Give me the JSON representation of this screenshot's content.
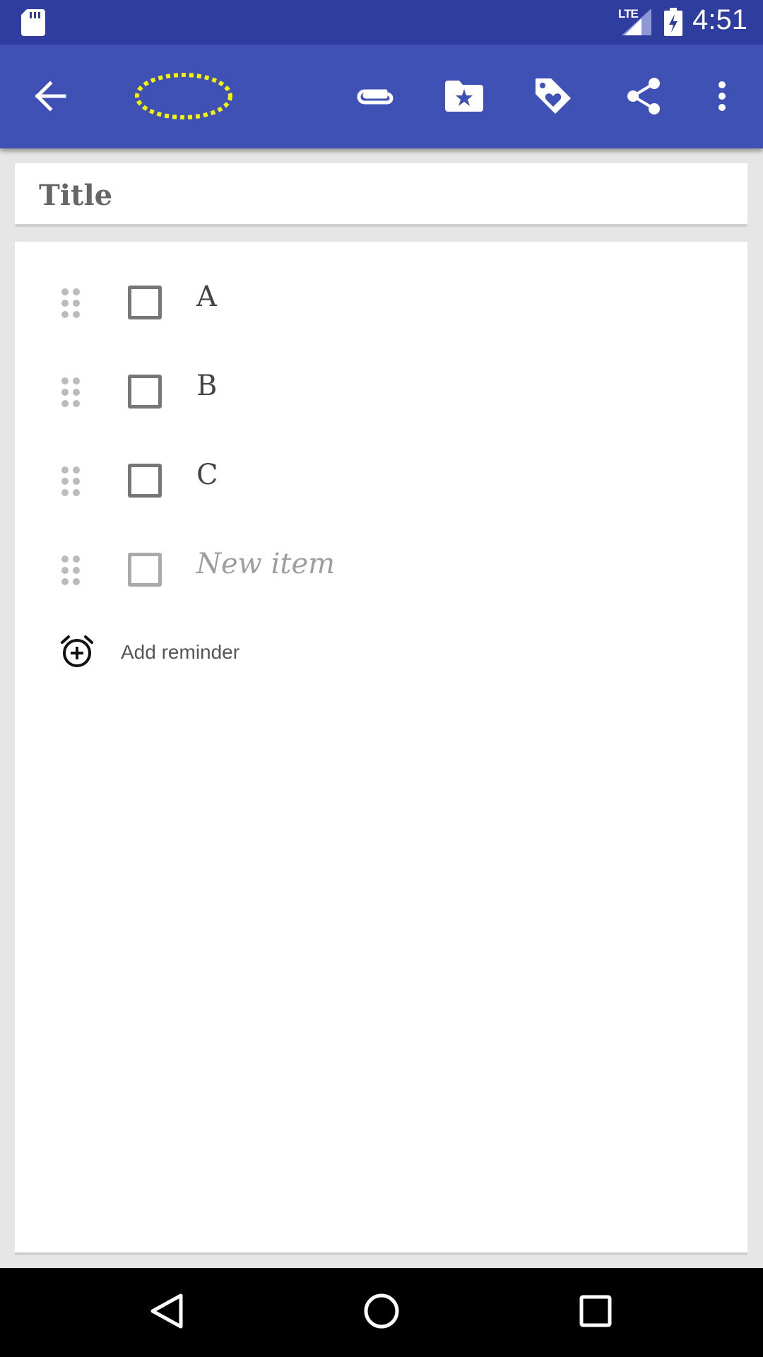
{
  "status_bar": {
    "network": "LTE",
    "time": "4:51"
  },
  "toolbar": {
    "icons": [
      "back-arrow-icon",
      "highlight-ellipse-icon",
      "attachment-icon",
      "folder-star-icon",
      "tag-heart-icon",
      "share-icon",
      "more-vert-icon"
    ]
  },
  "note": {
    "title_placeholder": "Title",
    "items": [
      {
        "text": "A",
        "checked": false
      },
      {
        "text": "B",
        "checked": false
      },
      {
        "text": "C",
        "checked": false
      }
    ],
    "new_item_placeholder": "New item",
    "add_reminder_label": "Add reminder"
  },
  "colors": {
    "status_bar": "#2f3d9e",
    "toolbar": "#3f51b5",
    "highlight": "#f5f500"
  }
}
